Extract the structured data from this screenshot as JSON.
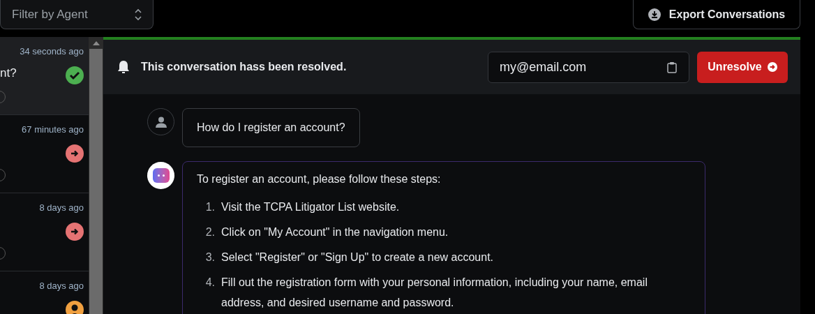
{
  "filter": {
    "placeholder": "Filter by Agent"
  },
  "export_button": {
    "label": "Export Conversations"
  },
  "conversations": [
    {
      "preview": "nt?",
      "time": "34 seconds ago",
      "kind": "resolved",
      "color": "#4caf50",
      "selected": true
    },
    {
      "time": "67 minutes ago",
      "kind": "open",
      "color": "#e57373",
      "selected": false
    },
    {
      "time": "8 days ago",
      "kind": "open",
      "color": "#e57373",
      "selected": false
    },
    {
      "time": "8 days ago",
      "kind": "agent",
      "color": "#f0a040",
      "selected": false
    }
  ],
  "banner": {
    "resolved": true,
    "text": "This conversation hass been resolved.",
    "email": "my@email.com",
    "button": "Unresolve"
  },
  "messages": [
    {
      "kind": "user",
      "text": "How do I register an account?"
    },
    {
      "kind": "assistant",
      "text": "To register an account, please follow these steps:",
      "steps": [
        {
          "number": "1.",
          "text": "Visit the TCPA Litigator List website."
        },
        {
          "number": "2.",
          "text": "Click on \"My Account\" in the navigation menu."
        },
        {
          "number": "3.",
          "text": "Select \"Register\" or \"Sign Up\" to create a new account."
        },
        {
          "number": "4.",
          "text": "Fill out the registration form with your personal information, including your name, email address, and desired username and password."
        }
      ]
    }
  ]
}
